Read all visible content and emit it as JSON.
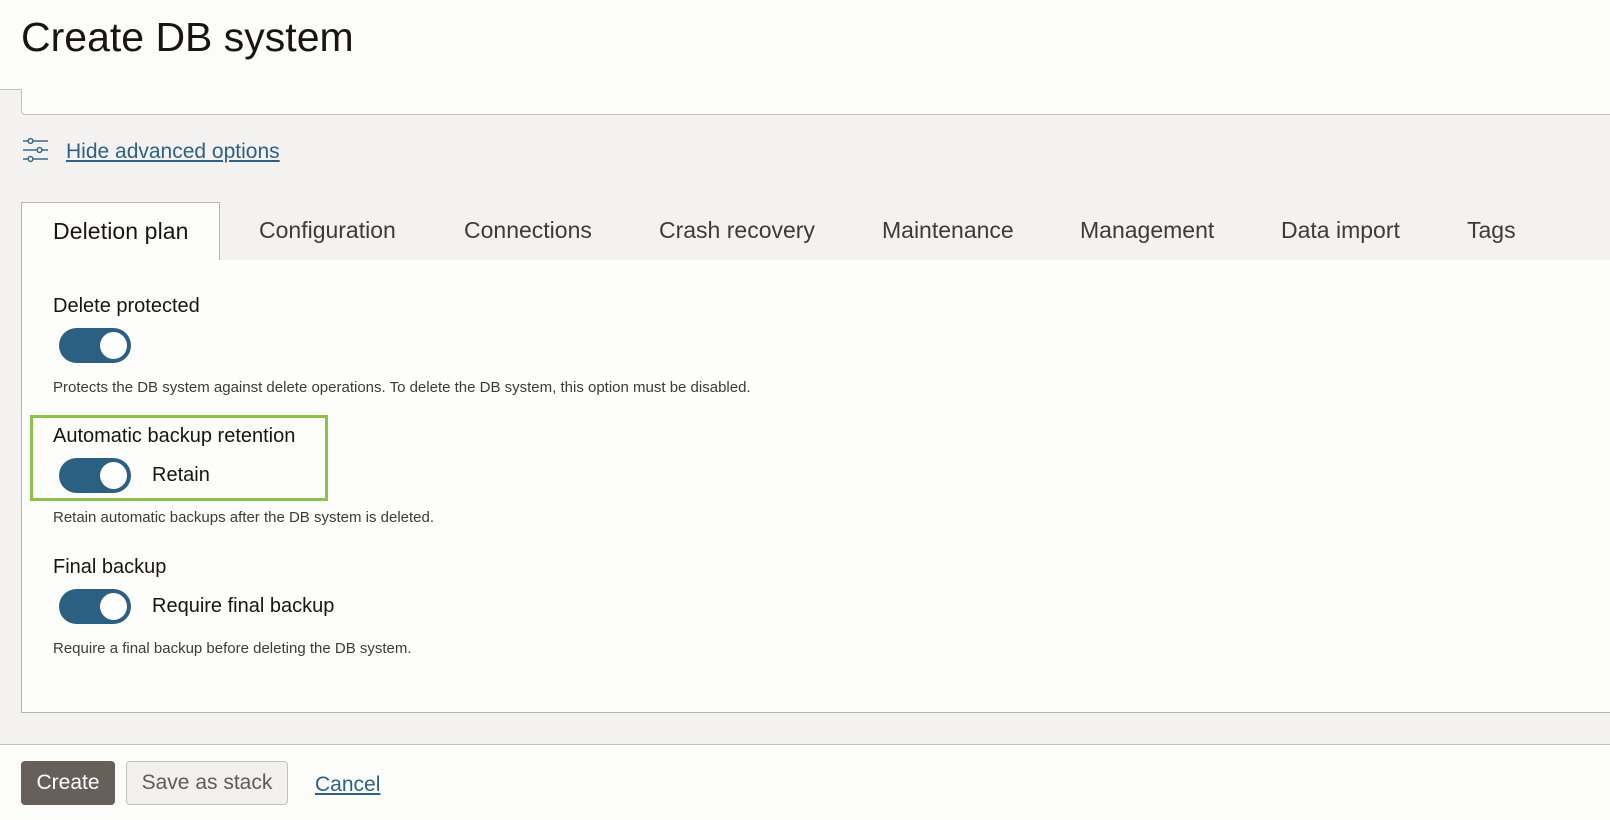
{
  "header": {
    "title": "Create DB system"
  },
  "advanced": {
    "link": "Hide advanced options",
    "icon": "sliders-icon"
  },
  "tabs": [
    {
      "label": "Deletion plan",
      "active": true
    },
    {
      "label": "Configuration"
    },
    {
      "label": "Connections"
    },
    {
      "label": "Crash recovery"
    },
    {
      "label": "Maintenance"
    },
    {
      "label": "Management"
    },
    {
      "label": "Data import"
    },
    {
      "label": "Tags"
    }
  ],
  "deletion_plan": {
    "delete_protected": {
      "label": "Delete protected",
      "enabled": true,
      "help": "Protects the DB system against delete operations. To delete the DB system, this option must be disabled."
    },
    "backup_retention": {
      "label": "Automatic backup retention",
      "enabled": true,
      "toggle_label": "Retain",
      "help": "Retain automatic backups after the DB system is deleted."
    },
    "final_backup": {
      "label": "Final backup",
      "enabled": true,
      "toggle_label": "Require final backup",
      "help": "Require a final backup before deleting the DB system."
    }
  },
  "footer": {
    "create": "Create",
    "save_stack": "Save as stack",
    "cancel": "Cancel"
  },
  "colors": {
    "accent": "#2b6083",
    "link": "#2e6184",
    "highlight": "#8bc34a",
    "primary_button": "#665f5a"
  }
}
